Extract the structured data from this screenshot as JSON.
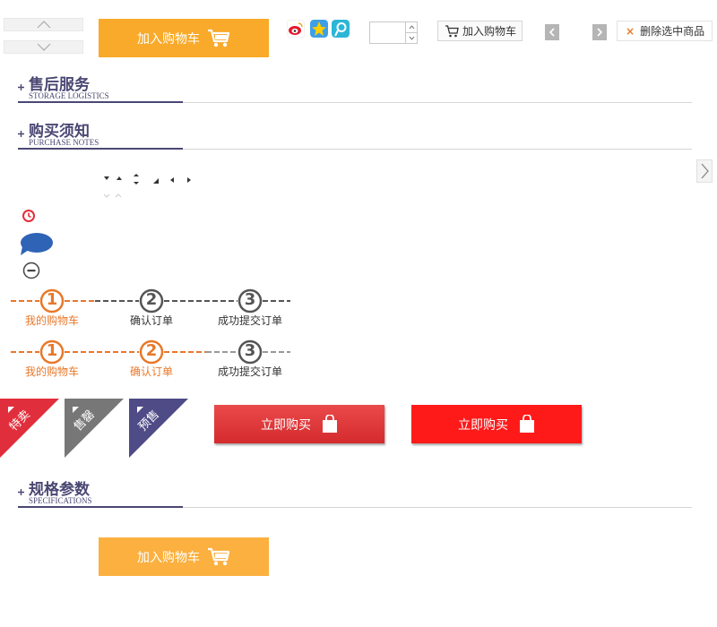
{
  "cart_button": {
    "label": "加入购物车"
  },
  "cart_button_bottom": {
    "label": "加入购物车"
  },
  "quantity": {
    "value": ""
  },
  "small_cart_button": {
    "label": "加入购物车"
  },
  "delete_selected": {
    "label": "删除选中商品",
    "icon": "×"
  },
  "sections": [
    {
      "title": "售后服务",
      "subtitle": "STORAGE LOGISTICS"
    },
    {
      "title": "购买须知",
      "subtitle": "PURCHASE NOTES"
    },
    {
      "title": "规格参数",
      "subtitle": "SPECIFICATIONS"
    }
  ],
  "steps_a": {
    "numbers": [
      "1",
      "2",
      "3"
    ],
    "labels": [
      "我的购物车",
      "确认订单",
      "成功提交订单"
    ],
    "active": 1
  },
  "steps_b": {
    "numbers": [
      "1",
      "2",
      "3"
    ],
    "labels": [
      "我的购物车",
      "确认订单",
      "成功提交订单"
    ],
    "active": 2
  },
  "ribbons": [
    {
      "label": "特卖",
      "color": "#e12e3c"
    },
    {
      "label": "售罄",
      "color": "#777777"
    },
    {
      "label": "预售",
      "color": "#4f4b86"
    }
  ],
  "buy_buttons": [
    {
      "label": "立即购买",
      "color": "#e03437"
    },
    {
      "label": "立即购买",
      "color": "#ff1a1a"
    }
  ],
  "colors": {
    "orange": "#f9aa2a",
    "purple": "#4a4773",
    "step_orange": "#e8782a",
    "step_gray": "#555555"
  },
  "icons": [
    "weibo-icon",
    "qzone-icon",
    "tqq-icon",
    "clock-icon",
    "speech-bubble-icon",
    "minus-circle-icon",
    "cart-icon",
    "shopping-bag-icon"
  ]
}
